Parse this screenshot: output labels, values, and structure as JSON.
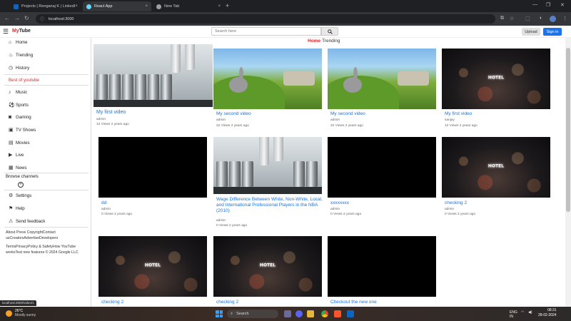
{
  "browser": {
    "tabs": [
      {
        "label": "Projects | Renganaj K | LinkedIn",
        "icon": "linkedin-icon",
        "color": "#0a66c2"
      },
      {
        "label": "React App",
        "icon": "react-icon",
        "color": "#61dafb"
      },
      {
        "label": "New Tab",
        "icon": "chrome-icon",
        "color": "#9aa0a6"
      }
    ],
    "url": "localhost:3000"
  },
  "app": {
    "brand_accent": "My",
    "brand_rest": "Tube",
    "search_placeholder": "Search here",
    "upload_label": "Upload",
    "signin_label": "Sign in"
  },
  "sidebar": {
    "items": [
      {
        "label": "Home",
        "icon": "home-icon"
      },
      {
        "label": "Trending",
        "icon": "flame-icon"
      },
      {
        "label": "History",
        "icon": "history-icon"
      }
    ],
    "best_title": "Best of youtube",
    "categories": [
      {
        "label": "Music",
        "icon": "music-icon"
      },
      {
        "label": "Sports",
        "icon": "sports-icon"
      },
      {
        "label": "Gaming",
        "icon": "gamepad-icon"
      },
      {
        "label": "TV Shows",
        "icon": "tv-icon"
      },
      {
        "label": "Movies",
        "icon": "film-icon"
      },
      {
        "label": "Live",
        "icon": "live-icon"
      },
      {
        "label": "News",
        "icon": "news-icon"
      }
    ],
    "browse_title": "Browse channels",
    "settings": [
      {
        "label": "Settings",
        "icon": "gear-icon"
      },
      {
        "label": "Help",
        "icon": "help-icon"
      },
      {
        "label": "Send feedback",
        "icon": "warning-icon"
      }
    ],
    "footer1": "About Press CopyrightContact usCreatorsAdvertiseDevelopers",
    "footer2": "TermsPrivacyPolicy & SafetyHow YouTube worksTest new features © 2024 Google LLC"
  },
  "nav": {
    "home": "Home",
    "trending": "Trending"
  },
  "videos": [
    {
      "title": "My first video",
      "channel": "admin",
      "meta": "12 Views 2 years ago",
      "thumb": "cans"
    },
    {
      "title": "My second video",
      "channel": "admin",
      "meta": "22 Views 2 years ago",
      "thumb": "bunny"
    },
    {
      "title": "My second video",
      "channel": "admin",
      "meta": "22 Views 2 years ago",
      "thumb": "bunny"
    },
    {
      "title": "My first video",
      "channel": "sanjay",
      "meta": "12 Views 2 years ago",
      "thumb": "city"
    },
    {
      "title": "dd",
      "channel": "admin",
      "meta": "0 Views 2 years ago",
      "thumb": "black"
    },
    {
      "title": "Wage Difference Between White, Non-White, Local, and International Professional Players in the NBA (2010)",
      "channel": "admin",
      "meta": "0 Views 2 years ago",
      "thumb": "cans"
    },
    {
      "title": "xxxxxxxx",
      "channel": "admin",
      "meta": "0 Views 2 years ago",
      "thumb": "black"
    },
    {
      "title": "checking 2",
      "channel": "admin",
      "meta": "0 Views 2 years ago",
      "thumb": "city"
    },
    {
      "title": "checking 2",
      "channel": "",
      "meta": "",
      "thumb": "city"
    },
    {
      "title": "checking 2",
      "channel": "",
      "meta": "",
      "thumb": "city"
    },
    {
      "title": "Checkout the new one",
      "channel": "",
      "meta": "",
      "thumb": "black"
    }
  ],
  "city_sign": "HOTEL",
  "status_url": "localhost:3000/video/1",
  "taskbar": {
    "temp": "26°C",
    "weather": "Mostly sunny",
    "search": "Search",
    "lang": "ENG",
    "region": "IN",
    "time": "08:31",
    "date": "28-02-2024"
  },
  "colors": {
    "accent": "#d32f2f",
    "link": "#1a73e8",
    "signin": "#1a73e8"
  }
}
